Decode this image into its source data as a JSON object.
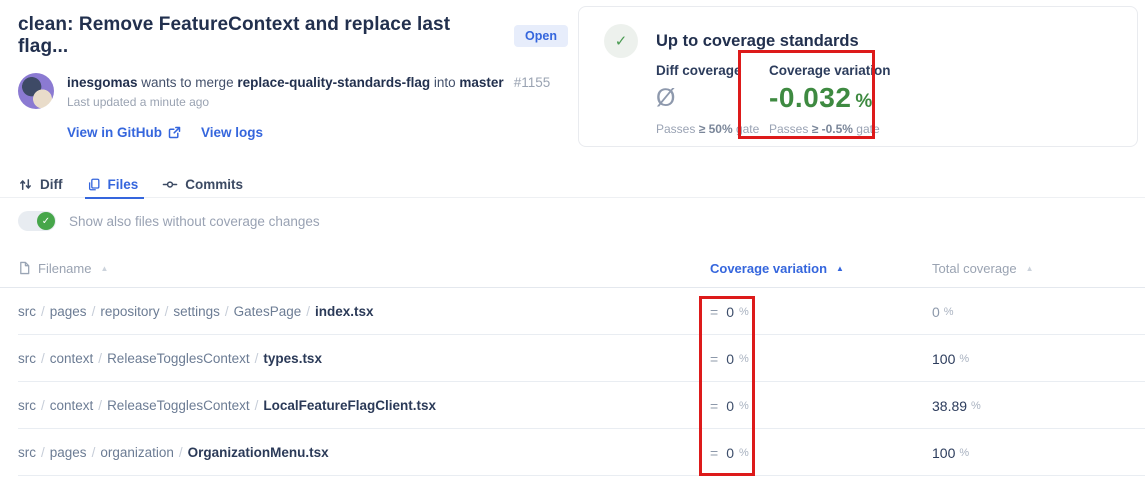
{
  "header": {
    "title": "clean: Remove FeatureContext and replace last flag...",
    "status_badge": "Open",
    "byline": {
      "author": "inesgomas",
      "action": " wants to merge ",
      "source_branch": "replace-quality-standards-flag",
      "into": " into ",
      "target_branch": "master",
      "pr_number": "#1155",
      "last_updated": "Last updated a minute ago"
    },
    "links": {
      "view_in_github": "View in GitHub",
      "view_logs": "View logs"
    }
  },
  "coverage_card": {
    "status_title": "Up to coverage standards",
    "status_icon": "check",
    "diff_coverage": {
      "label": "Diff coverage",
      "value_icon": "empty-set",
      "value_glyph": "Ø",
      "gate_prefix": "Passes ",
      "gate_threshold": "≥ 50%",
      "gate_suffix": " gate"
    },
    "coverage_variation": {
      "label": "Coverage variation",
      "value": "-0.032",
      "unit": "%",
      "gate_prefix": "Passes ",
      "gate_threshold": "≥ -0.5%",
      "gate_suffix": " gate"
    }
  },
  "tabs": [
    {
      "label": "Diff",
      "icon": "git-compare",
      "active": false
    },
    {
      "label": "Files",
      "icon": "files",
      "active": true
    },
    {
      "label": "Commits",
      "icon": "git-commit",
      "active": false
    }
  ],
  "toggle": {
    "label": "Show also files without coverage changes",
    "state": "on"
  },
  "table": {
    "headers": {
      "filename": "Filename",
      "coverage_variation": "Coverage variation",
      "total_coverage": "Total coverage",
      "sort_icon": "▲"
    },
    "rows": [
      {
        "path": [
          "src",
          "pages",
          "repository",
          "settings",
          "GatesPage"
        ],
        "file": "index.tsx",
        "variation_sign": "=",
        "variation": "0",
        "variation_unit": "%",
        "total": "0",
        "total_unit": "%",
        "total_muted": true
      },
      {
        "path": [
          "src",
          "context",
          "ReleaseTogglesContext"
        ],
        "file": "types.tsx",
        "variation_sign": "=",
        "variation": "0",
        "variation_unit": "%",
        "total": "100",
        "total_unit": "%",
        "total_muted": false
      },
      {
        "path": [
          "src",
          "context",
          "ReleaseTogglesContext"
        ],
        "file": "LocalFeatureFlagClient.tsx",
        "variation_sign": "=",
        "variation": "0",
        "variation_unit": "%",
        "total": "38.89",
        "total_unit": "%",
        "total_muted": false
      },
      {
        "path": [
          "src",
          "pages",
          "organization"
        ],
        "file": "OrganizationMenu.tsx",
        "variation_sign": "=",
        "variation": "0",
        "variation_unit": "%",
        "total": "100",
        "total_unit": "%",
        "total_muted": false
      }
    ],
    "path_separator": "/"
  },
  "colors": {
    "accent_blue": "#3566dd",
    "success_green": "#3e8a41",
    "toggle_green": "#46a64a",
    "annotation_red": "#dd1a1a",
    "dark_navy_text": "#22304e",
    "muted_gray_text": "#9aa3b2",
    "open_badge_bg": "#e7edfb"
  }
}
